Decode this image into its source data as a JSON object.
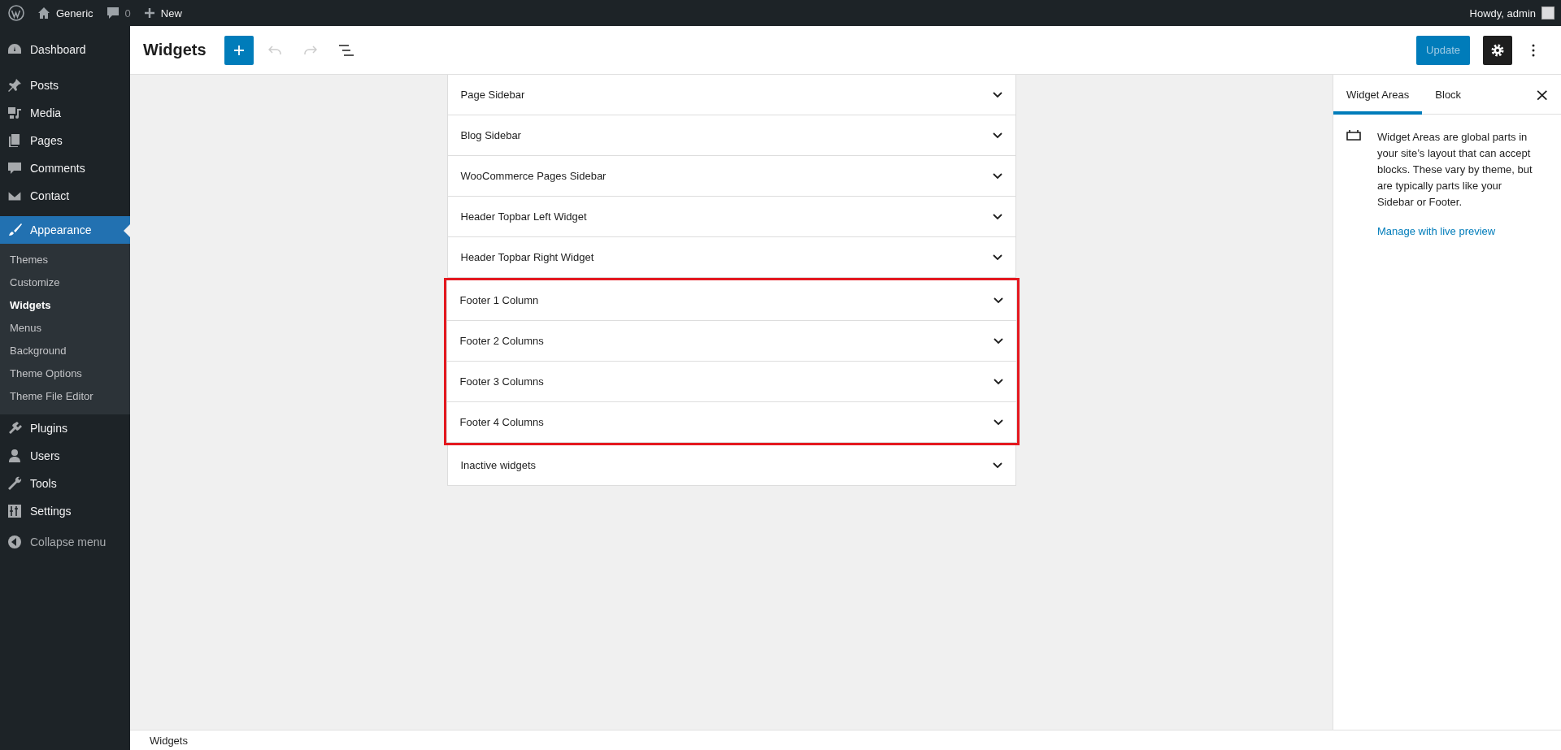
{
  "admin_bar": {
    "site": "Generic",
    "comments": "0",
    "new": "New",
    "greeting": "Howdy, admin"
  },
  "menu": [
    {
      "label": "Dashboard",
      "selected": false
    },
    {
      "label": "Posts",
      "selected": false
    },
    {
      "label": "Media",
      "selected": false
    },
    {
      "label": "Pages",
      "selected": false
    },
    {
      "label": "Comments",
      "selected": false
    },
    {
      "label": "Contact",
      "selected": false
    },
    {
      "label": "Appearance",
      "selected": true,
      "children": [
        {
          "label": "Themes",
          "selected": false
        },
        {
          "label": "Customize",
          "selected": false
        },
        {
          "label": "Widgets",
          "selected": true
        },
        {
          "label": "Menus",
          "selected": false
        },
        {
          "label": "Background",
          "selected": false
        },
        {
          "label": "Theme Options",
          "selected": false
        },
        {
          "label": "Theme File Editor",
          "selected": false
        }
      ]
    },
    {
      "label": "Plugins",
      "selected": false
    },
    {
      "label": "Users",
      "selected": false
    },
    {
      "label": "Tools",
      "selected": false
    },
    {
      "label": "Settings",
      "selected": false
    },
    {
      "label": "Collapse menu",
      "selected": false
    }
  ],
  "header": {
    "title": "Widgets",
    "update": "Update"
  },
  "widget_areas": [
    {
      "name": "Page Sidebar",
      "highlighted": false
    },
    {
      "name": "Blog Sidebar",
      "highlighted": false
    },
    {
      "name": "WooCommerce Pages Sidebar",
      "highlighted": false
    },
    {
      "name": "Header Topbar Left Widget",
      "highlighted": false
    },
    {
      "name": "Header Topbar Right Widget",
      "highlighted": false
    },
    {
      "name": "Footer 1 Column",
      "highlighted": true
    },
    {
      "name": "Footer 2 Columns",
      "highlighted": true
    },
    {
      "name": "Footer 3 Columns",
      "highlighted": true
    },
    {
      "name": "Footer 4 Columns",
      "highlighted": true
    },
    {
      "name": "Inactive widgets",
      "highlighted": false
    }
  ],
  "settings_panel": {
    "tabs": [
      {
        "label": "Widget Areas",
        "selected": true
      },
      {
        "label": "Block",
        "selected": false
      }
    ],
    "close": "×",
    "description": "Widget Areas are global parts in your site’s layout that can accept blocks. These vary by theme, but are typically parts like your Sidebar or Footer.",
    "link": "Manage with live preview"
  },
  "footer": {
    "breadcrumb": "Widgets"
  }
}
